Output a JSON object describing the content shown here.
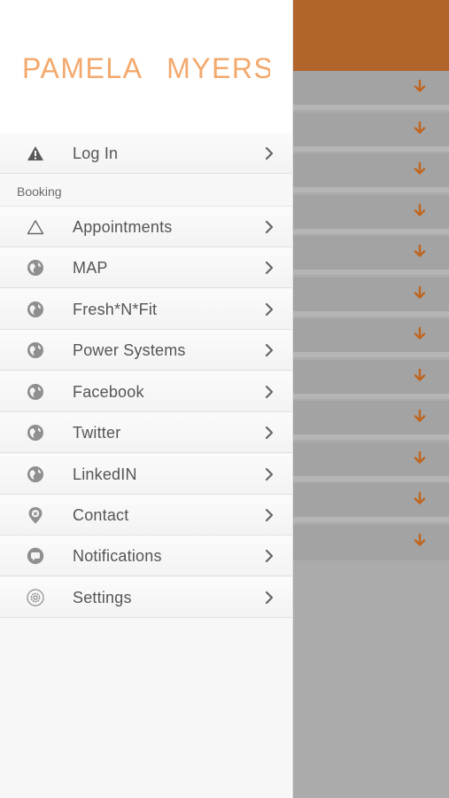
{
  "brand": {
    "title": "PAMELA MYERS",
    "color": "#f3a86c"
  },
  "login": {
    "label": "Log In",
    "icon": "warning-icon"
  },
  "section": {
    "booking": "Booking"
  },
  "menu": [
    {
      "label": "Appointments",
      "icon": "triangle-outline-icon"
    },
    {
      "label": "MAP",
      "icon": "globe-icon"
    },
    {
      "label": "Fresh*N*Fit",
      "icon": "globe-icon"
    },
    {
      "label": "Power Systems",
      "icon": "globe-icon"
    },
    {
      "label": "Facebook",
      "icon": "globe-icon"
    },
    {
      "label": "Twitter",
      "icon": "globe-icon"
    },
    {
      "label": "LinkedIN",
      "icon": "globe-icon"
    },
    {
      "label": "Contact",
      "icon": "location-pin-icon"
    },
    {
      "label": "Notifications",
      "icon": "chat-bubble-icon"
    },
    {
      "label": "Settings",
      "icon": "gear-icon"
    }
  ],
  "colors": {
    "accent": "#b2652a",
    "arrow": "#c0651f",
    "text": "#555555",
    "icon": "#8f8f8f"
  }
}
